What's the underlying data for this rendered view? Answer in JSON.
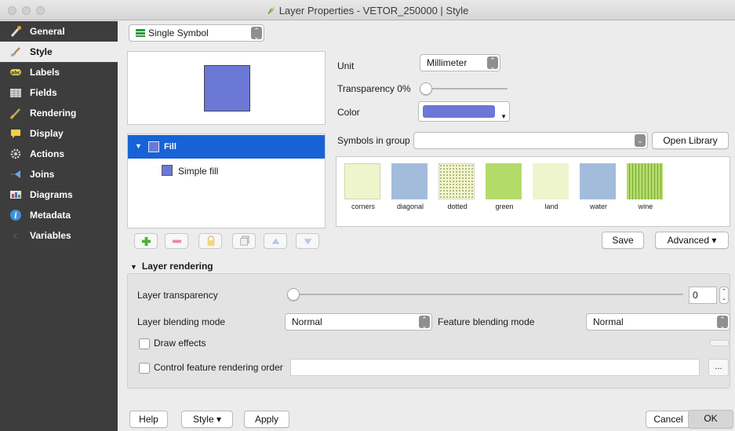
{
  "window": {
    "title": "Layer Properties - VETOR_250000 | Style"
  },
  "sidebar": {
    "items": [
      {
        "label": "General",
        "icon": "wrench-icon"
      },
      {
        "label": "Style",
        "icon": "paint-brush-icon",
        "selected": true
      },
      {
        "label": "Labels",
        "icon": "labels-icon"
      },
      {
        "label": "Fields",
        "icon": "table-icon"
      },
      {
        "label": "Rendering",
        "icon": "brush-icon"
      },
      {
        "label": "Display",
        "icon": "speech-bubble-icon"
      },
      {
        "label": "Actions",
        "icon": "gear-icon"
      },
      {
        "label": "Joins",
        "icon": "join-icon"
      },
      {
        "label": "Diagrams",
        "icon": "diagram-icon"
      },
      {
        "label": "Metadata",
        "icon": "info-icon"
      },
      {
        "label": "Variables",
        "icon": "variables-icon"
      }
    ]
  },
  "renderer": {
    "value": "Single Symbol"
  },
  "symbol": {
    "preview_color": "#6b78d6",
    "tree": {
      "root": "Fill",
      "child": "Simple fill"
    }
  },
  "properties": {
    "unit_label": "Unit",
    "unit_value": "Millimeter",
    "transparency_label": "Transparency 0%",
    "transparency_value": 0,
    "color_label": "Color",
    "color_value": "#6b78d6"
  },
  "library": {
    "group_label": "Symbols in group",
    "group_value": "",
    "open_library": "Open Library",
    "swatches": [
      {
        "label": "corners",
        "color": "#eef5cd"
      },
      {
        "label": "diagonal",
        "color": "#a4bcdc"
      },
      {
        "label": "dotted",
        "color": "#f2f5cf"
      },
      {
        "label": "green",
        "color": "#b3db69"
      },
      {
        "label": "land",
        "color": "#eef5cd"
      },
      {
        "label": "water",
        "color": "#a4bcdc"
      },
      {
        "label": "wine",
        "color": "#b3db69"
      }
    ],
    "save": "Save",
    "advanced": "Advanced ▾"
  },
  "layer_rendering": {
    "section_title": "Layer rendering",
    "transparency_label": "Layer transparency",
    "transparency_value": "0",
    "blending_label": "Layer blending mode",
    "blending_value": "Normal",
    "feature_blending_label": "Feature blending mode",
    "feature_blending_value": "Normal",
    "draw_effects": "Draw effects",
    "control_order": "Control feature rendering order",
    "ellipsis": "..."
  },
  "footer": {
    "help": "Help",
    "style": "Style ▾",
    "apply": "Apply",
    "cancel": "Cancel",
    "ok": "OK"
  }
}
